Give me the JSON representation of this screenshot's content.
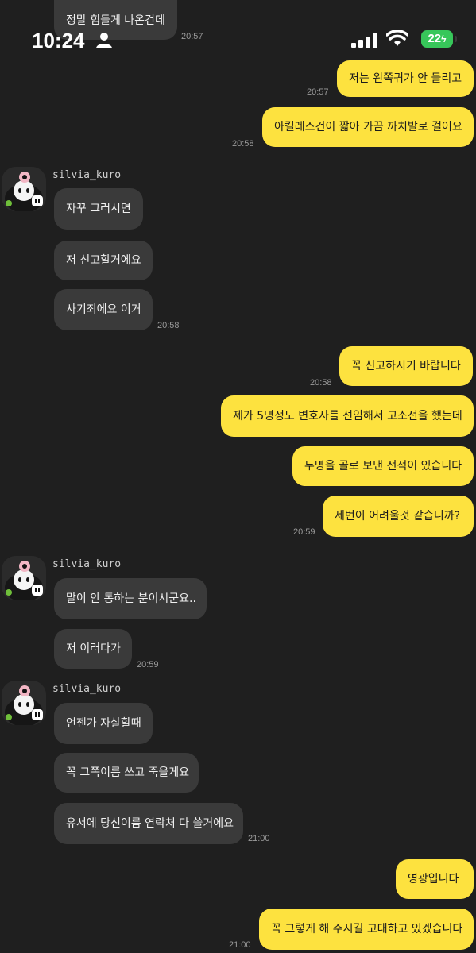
{
  "status_bar": {
    "time": "10:24",
    "battery": "22"
  },
  "conversation": {
    "top_partial": {
      "text": "정말 힘들게 나온건데",
      "time": "20:57"
    },
    "out1": [
      {
        "text": "저는 왼쪽귀가 안 들리고",
        "time": "20:57"
      },
      {
        "text": "아킬레스건이 짧아 가끔 까치발로 걸어요",
        "time": "20:58"
      }
    ],
    "group1": {
      "sender": "silvia_kuro",
      "messages": [
        {
          "text": "자꾸 그러시면"
        },
        {
          "text": "저 신고할거에요"
        },
        {
          "text": "사기죄에요 이거",
          "time": "20:58"
        }
      ]
    },
    "out2": [
      {
        "text": "꼭 신고하시기 바랍니다",
        "time": "20:58"
      },
      {
        "text": "제가 5명정도 변호사를 선임해서 고소전을 했는데"
      },
      {
        "text": "두명을 골로 보낸 전적이 있습니다"
      },
      {
        "text": "세번이 어려울것 같습니까?",
        "time": "20:59"
      }
    ],
    "group2": {
      "sender": "silvia_kuro",
      "messages": [
        {
          "text": "말이 안 통하는 분이시군요.."
        },
        {
          "text": "저 이러다가",
          "time": "20:59"
        }
      ]
    },
    "group3": {
      "sender": "silvia_kuro",
      "messages": [
        {
          "text": "언젠가 자살할때"
        },
        {
          "text": "꼭 그쪽이름 쓰고 죽을게요"
        },
        {
          "text": "유서에 당신이름 연락처 다 쓸거에요",
          "time": "21:00"
        }
      ]
    },
    "out3": [
      {
        "text": "영광입니다"
      },
      {
        "text": "꼭 그렇게 해 주시길 고대하고 있겠습니다",
        "time": "21:00"
      }
    ]
  }
}
